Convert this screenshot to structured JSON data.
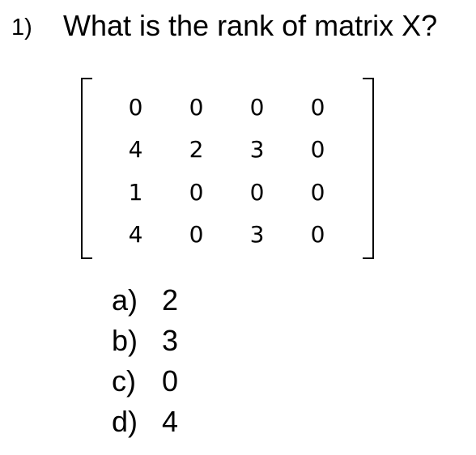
{
  "question": {
    "number": "1)",
    "text": "What is the rank of matrix X?"
  },
  "matrix": {
    "rows": [
      [
        "0",
        "0",
        "0",
        "0"
      ],
      [
        "4",
        "2",
        "3",
        "0"
      ],
      [
        "1",
        "0",
        "0",
        "0"
      ],
      [
        "4",
        "0",
        "3",
        "0"
      ]
    ]
  },
  "options": [
    {
      "letter": "a)",
      "value": "2"
    },
    {
      "letter": "b)",
      "value": "3"
    },
    {
      "letter": "c)",
      "value": "0"
    },
    {
      "letter": "d)",
      "value": "4"
    }
  ]
}
